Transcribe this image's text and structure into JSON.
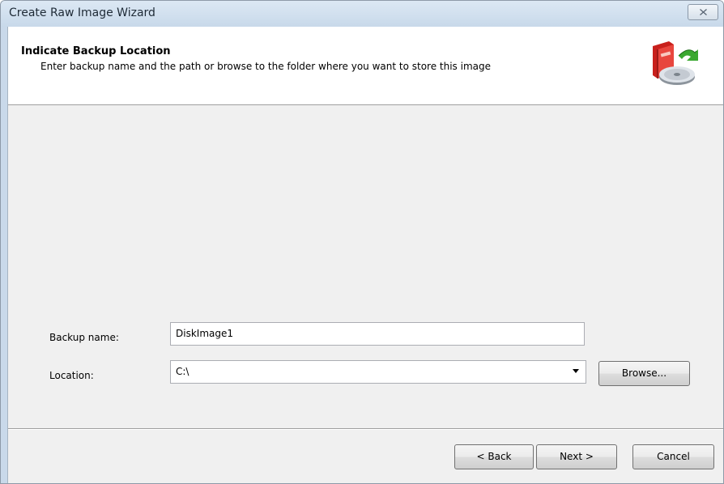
{
  "window": {
    "title": "Create Raw Image Wizard"
  },
  "header": {
    "title": "Indicate Backup Location",
    "description": "Enter backup name and the path or browse to the folder where you want to store this image",
    "icon": "backup-disk-icon"
  },
  "form": {
    "backup_name_label": "Backup name:",
    "backup_name_value": "DiskImage1",
    "location_label": "Location:",
    "location_value": "C:\\",
    "browse_label": "Browse..."
  },
  "footer": {
    "back_label": "< Back",
    "next_label": "Next >",
    "cancel_label": "Cancel"
  },
  "colors": {
    "title_bar": "#c8d9ea",
    "client_background": "#f0f0f0",
    "header_background": "#ffffff"
  }
}
